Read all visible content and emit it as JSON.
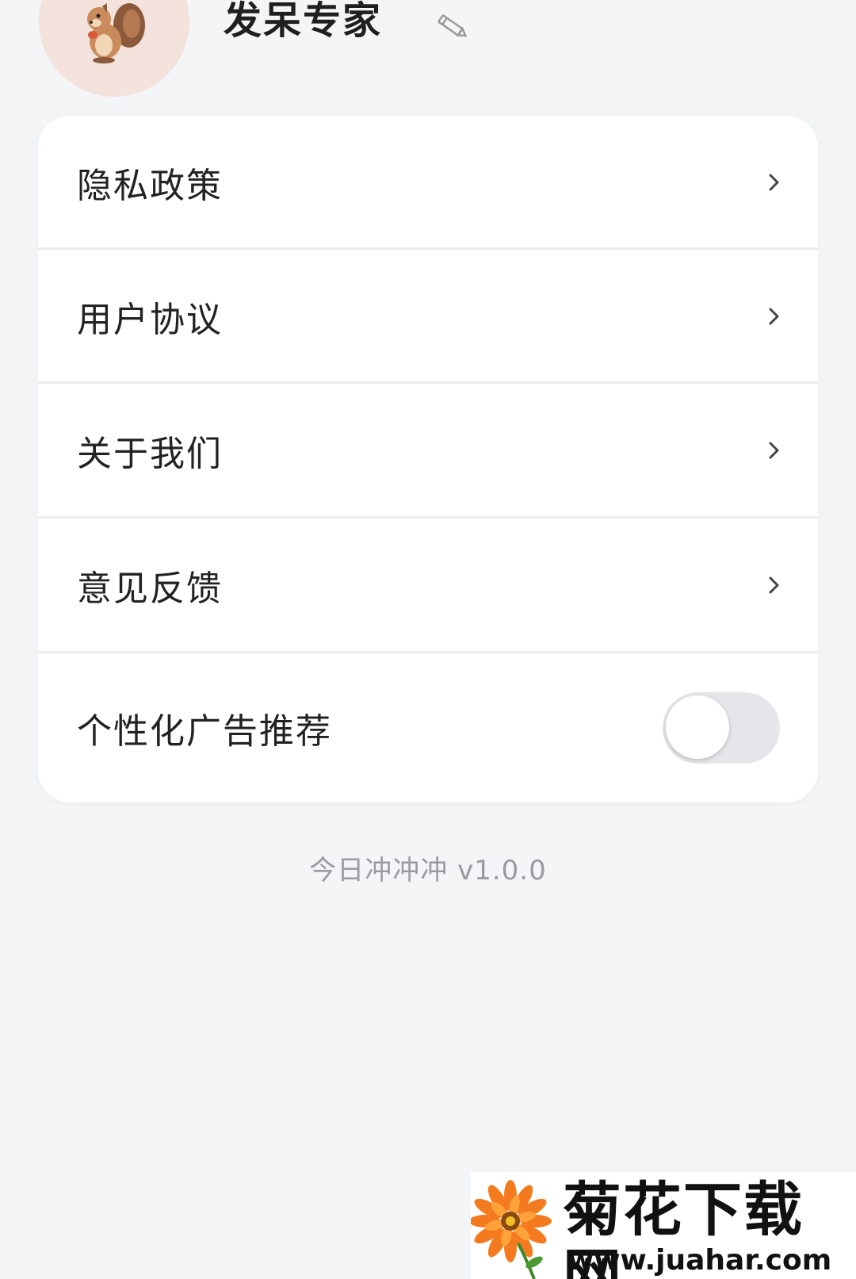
{
  "profile": {
    "username": "发呆专家",
    "avatar_icon": "squirrel-icon",
    "edit_icon": "pencil-icon"
  },
  "menu": {
    "items": [
      {
        "label": "隐私政策",
        "icon": "chevron-right-icon"
      },
      {
        "label": "用户协议",
        "icon": "chevron-right-icon"
      },
      {
        "label": "关于我们",
        "icon": "chevron-right-icon"
      },
      {
        "label": "意见反馈",
        "icon": "chevron-right-icon"
      }
    ],
    "toggle": {
      "label": "个性化广告推荐",
      "enabled": false
    }
  },
  "footer": {
    "version": "今日冲冲冲 v1.0.0"
  },
  "watermark": {
    "title": "菊花下载网",
    "url": "www.juahar.com",
    "icon": "flower-icon"
  },
  "colors": {
    "background": "#f4f5f7",
    "card": "#ffffff",
    "avatar_bg": "#f4e3dc",
    "toggle_off": "#e6e6ea"
  }
}
